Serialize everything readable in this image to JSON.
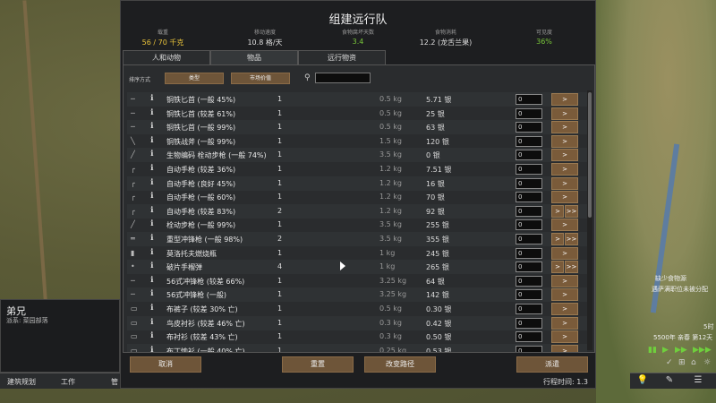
{
  "dialog": {
    "title": "组建远行队",
    "stats": [
      {
        "label": "载重",
        "value": "56 / 70 千克",
        "color": "#e8c23a"
      },
      {
        "label": "移动速度",
        "value": "10.8 格/天",
        "color": "#dddddd"
      },
      {
        "label": "食物腐坏天数",
        "value": "3.4",
        "color": "#78c43a"
      },
      {
        "label": "食物消耗",
        "value": "12.2 (龙舌兰果)",
        "color": "#dddddd"
      },
      {
        "label": "可见度",
        "value": "36%",
        "color": "#78c43a"
      }
    ],
    "tabs": [
      "人和动物",
      "物品",
      "远行物资"
    ],
    "active_tab": "物品",
    "sort_label": "排序方式",
    "sort_buttons": [
      "类型",
      "市场价值"
    ],
    "search_placeholder": "",
    "rows": [
      {
        "name": "铜铁匕首 (一般 45%)",
        "count": "1",
        "mass": "0.5 kg",
        "value": "5.71 银",
        "qty": "0",
        "buttons": [
          ">"
        ]
      },
      {
        "name": "铜铁匕首 (较差 61%)",
        "count": "1",
        "mass": "0.5 kg",
        "value": "25 银",
        "qty": "0",
        "buttons": [
          ">"
        ]
      },
      {
        "name": "铜铁匕首 (一般 99%)",
        "count": "1",
        "mass": "0.5 kg",
        "value": "63 银",
        "qty": "0",
        "buttons": [
          ">"
        ]
      },
      {
        "name": "铜铁战斧 (一般 99%)",
        "count": "1",
        "mass": "1.5 kg",
        "value": "120 银",
        "qty": "0",
        "buttons": [
          ">"
        ]
      },
      {
        "name": "生物编码 栓动步枪 (一般 74%)",
        "count": "1",
        "mass": "3.5 kg",
        "value": "0 银",
        "qty": "0",
        "buttons": [
          ">"
        ]
      },
      {
        "name": "自动手枪 (较差 36%)",
        "count": "1",
        "mass": "1.2 kg",
        "value": "7.51 银",
        "qty": "0",
        "buttons": [
          ">"
        ]
      },
      {
        "name": "自动手枪 (良好 45%)",
        "count": "1",
        "mass": "1.2 kg",
        "value": "16 银",
        "qty": "0",
        "buttons": [
          ">"
        ]
      },
      {
        "name": "自动手枪 (一般 60%)",
        "count": "1",
        "mass": "1.2 kg",
        "value": "70 银",
        "qty": "0",
        "buttons": [
          ">"
        ]
      },
      {
        "name": "自动手枪 (较差 83%)",
        "count": "2",
        "mass": "1.2 kg",
        "value": "92 银",
        "qty": "0",
        "buttons": [
          ">",
          ">>"
        ]
      },
      {
        "name": "栓动步枪 (一般 99%)",
        "count": "1",
        "mass": "3.5 kg",
        "value": "255 银",
        "qty": "0",
        "buttons": [
          ">"
        ]
      },
      {
        "name": "重型冲锋枪 (一般 98%)",
        "count": "2",
        "mass": "3.5 kg",
        "value": "355 银",
        "qty": "0",
        "buttons": [
          ">",
          ">>"
        ]
      },
      {
        "name": "莫洛托夫燃烧瓶",
        "count": "1",
        "mass": "1 kg",
        "value": "245 银",
        "qty": "0",
        "buttons": [
          ">"
        ]
      },
      {
        "name": "破片手榴弹",
        "count": "4",
        "mass": "1 kg",
        "value": "265 银",
        "qty": "0",
        "buttons": [
          ">",
          ">>"
        ]
      },
      {
        "name": "56式冲锋枪 (较差 66%)",
        "count": "1",
        "mass": "3.25 kg",
        "value": "64 银",
        "qty": "0",
        "buttons": [
          ">"
        ]
      },
      {
        "name": "56式冲锋枪 (一般)",
        "count": "1",
        "mass": "3.25 kg",
        "value": "142 银",
        "qty": "0",
        "buttons": [
          ">"
        ]
      },
      {
        "name": "布裤子 (较差 30% 亡)",
        "count": "1",
        "mass": "0.5 kg",
        "value": "0.30 银",
        "qty": "0",
        "buttons": [
          ">"
        ]
      },
      {
        "name": "鸟皮衬衫 (较差 46% 亡)",
        "count": "1",
        "mass": "0.3 kg",
        "value": "0.42 银",
        "qty": "0",
        "buttons": [
          ">"
        ]
      },
      {
        "name": "布衬衫 (较差 43% 亡)",
        "count": "1",
        "mass": "0.3 kg",
        "value": "0.50 银",
        "qty": "0",
        "buttons": [
          ">"
        ]
      },
      {
        "name": "布丁恤衫 (一般 40% 亡)",
        "count": "1",
        "mass": "0.25 kg",
        "value": "0.53 银",
        "qty": "0",
        "buttons": [
          ">"
        ]
      }
    ],
    "cancel": "取消",
    "reset": "重置",
    "change_route": "改变路径",
    "send": "派遣",
    "travel_time": "行程时间:  1.3"
  },
  "pawn": {
    "name": "弟兄",
    "faction": "派系: 菜园部落"
  },
  "bottom_bar": [
    "建筑规划",
    "工作",
    "管"
  ],
  "hud": {
    "alert1": "缺少食物源",
    "alert2": "遇萨满职位未被分配",
    "date_small": "5时",
    "date": "5500年 亲春 第12天"
  }
}
